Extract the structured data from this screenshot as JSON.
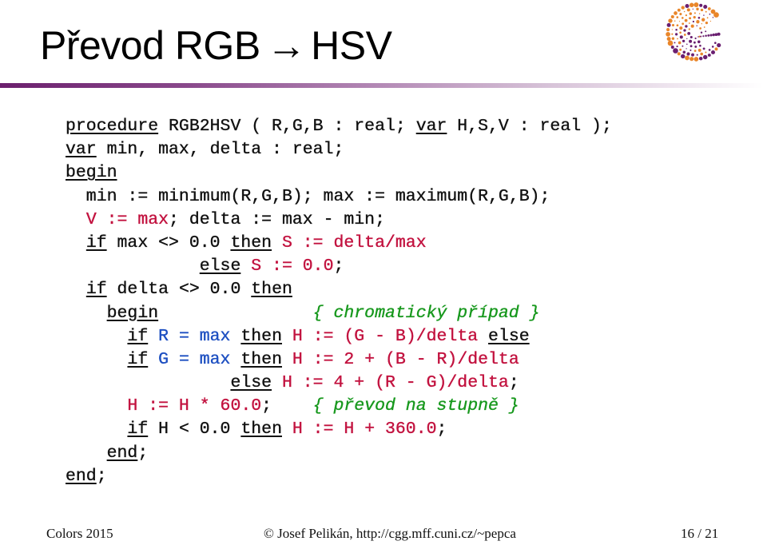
{
  "slide": {
    "title_before": "Převod RGB",
    "title_arrow": "→",
    "title_after": "HSV",
    "logo": "cgg-dotted-circle-logo"
  },
  "code": {
    "language": "pascal",
    "lines": [
      [
        {
          "t": "procedure",
          "s": "kw"
        },
        {
          "t": " RGB2HSV ( R,G,B : real; ",
          "s": "plain"
        },
        {
          "t": "var",
          "s": "kw"
        },
        {
          "t": " H,S,V : real );",
          "s": "plain"
        }
      ],
      [
        {
          "t": "var",
          "s": "kw"
        },
        {
          "t": " min, max, delta : real;",
          "s": "plain"
        }
      ],
      [
        {
          "t": "begin",
          "s": "kw"
        }
      ],
      [
        {
          "t": "  min := minimum(R,G,B); max := maximum(R,G,B);",
          "s": "plain"
        }
      ],
      [
        {
          "t": "  ",
          "s": "plain"
        },
        {
          "t": "V := max",
          "s": "red"
        },
        {
          "t": "; delta := max - min;",
          "s": "plain"
        }
      ],
      [
        {
          "t": "  ",
          "s": "plain"
        },
        {
          "t": "if",
          "s": "kw"
        },
        {
          "t": " max <> 0.0 ",
          "s": "plain"
        },
        {
          "t": "then",
          "s": "kw"
        },
        {
          "t": " ",
          "s": "plain"
        },
        {
          "t": "S := delta/max",
          "s": "red"
        }
      ],
      [
        {
          "t": "             ",
          "s": "plain"
        },
        {
          "t": "else",
          "s": "kw"
        },
        {
          "t": " ",
          "s": "plain"
        },
        {
          "t": "S := 0.0",
          "s": "red"
        },
        {
          "t": ";",
          "s": "plain"
        }
      ],
      [
        {
          "t": "  ",
          "s": "plain"
        },
        {
          "t": "if",
          "s": "kw"
        },
        {
          "t": " delta <> 0.0 ",
          "s": "plain"
        },
        {
          "t": "then",
          "s": "kw"
        }
      ],
      [
        {
          "t": "    ",
          "s": "plain"
        },
        {
          "t": "begin",
          "s": "kw"
        },
        {
          "t": "               ",
          "s": "plain"
        },
        {
          "t": "{ chromatický případ }",
          "s": "green"
        }
      ],
      [
        {
          "t": "      ",
          "s": "plain"
        },
        {
          "t": "if",
          "s": "kw"
        },
        {
          "t": " ",
          "s": "plain"
        },
        {
          "t": "R = max",
          "s": "blue"
        },
        {
          "t": " ",
          "s": "plain"
        },
        {
          "t": "then",
          "s": "kw"
        },
        {
          "t": " ",
          "s": "plain"
        },
        {
          "t": "H := (G - B)/delta",
          "s": "red"
        },
        {
          "t": " ",
          "s": "plain"
        },
        {
          "t": "else",
          "s": "kw"
        }
      ],
      [
        {
          "t": "      ",
          "s": "plain"
        },
        {
          "t": "if",
          "s": "kw"
        },
        {
          "t": " ",
          "s": "plain"
        },
        {
          "t": "G = max",
          "s": "blue"
        },
        {
          "t": " ",
          "s": "plain"
        },
        {
          "t": "then",
          "s": "kw"
        },
        {
          "t": " ",
          "s": "plain"
        },
        {
          "t": "H := 2 + (B - R)/delta",
          "s": "red"
        }
      ],
      [
        {
          "t": "                ",
          "s": "plain"
        },
        {
          "t": "else",
          "s": "kw"
        },
        {
          "t": " ",
          "s": "plain"
        },
        {
          "t": "H := 4 + (R - G)/delta",
          "s": "red"
        },
        {
          "t": ";",
          "s": "plain"
        }
      ],
      [
        {
          "t": "      ",
          "s": "plain"
        },
        {
          "t": "H := H * 60.0",
          "s": "red"
        },
        {
          "t": ";    ",
          "s": "plain"
        },
        {
          "t": "{ převod na stupně }",
          "s": "green"
        }
      ],
      [
        {
          "t": "      ",
          "s": "plain"
        },
        {
          "t": "if",
          "s": "kw"
        },
        {
          "t": " H < 0.0 ",
          "s": "plain"
        },
        {
          "t": "then",
          "s": "kw"
        },
        {
          "t": " ",
          "s": "plain"
        },
        {
          "t": "H := H + 360.0",
          "s": "red"
        },
        {
          "t": ";",
          "s": "plain"
        }
      ],
      [
        {
          "t": "    ",
          "s": "plain"
        },
        {
          "t": "end",
          "s": "kw"
        },
        {
          "t": ";",
          "s": "plain"
        }
      ],
      [
        {
          "t": "end",
          "s": "kw"
        },
        {
          "t": ";",
          "s": "plain"
        }
      ]
    ]
  },
  "colors": {
    "keyword": "#111111",
    "assignment_red": "#c2123f",
    "condition_blue": "#1d4fc1",
    "comment_green": "#17981d",
    "rule_purple": "#6b1f6d",
    "logo_purple": "#6a1f70",
    "logo_orange": "#e9862a"
  },
  "footer": {
    "course": "Colors 2015",
    "author": "© Josef Pelikán,  http://cgg.mff.cuni.cz/~pepca",
    "page": "16 / 21"
  }
}
